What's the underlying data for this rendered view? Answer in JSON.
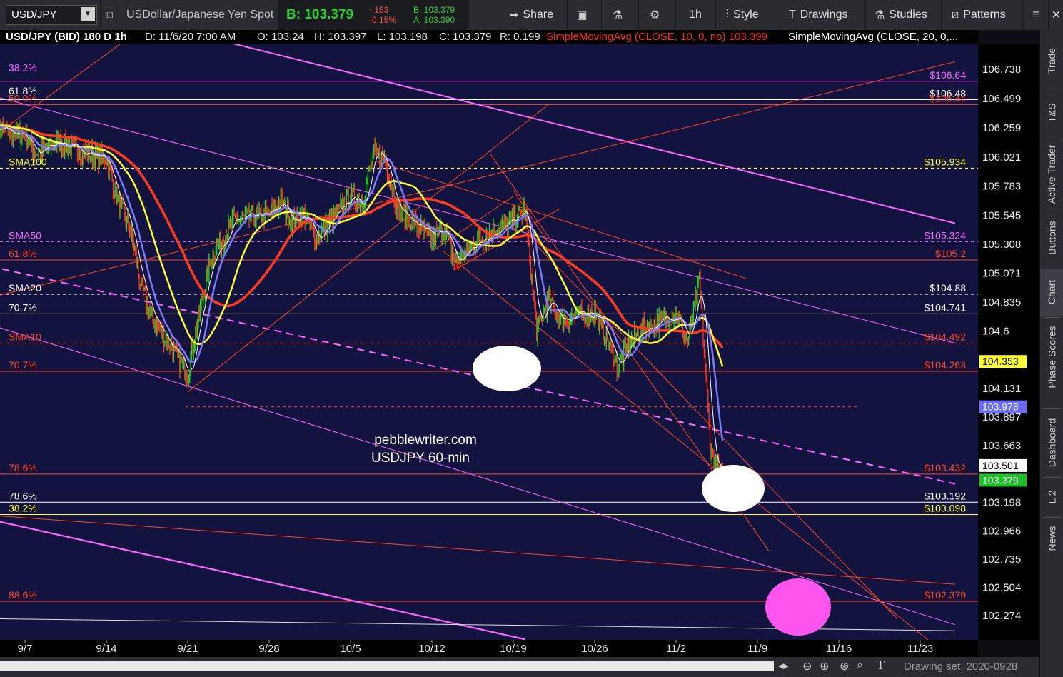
{
  "toolbar": {
    "symbol": "USD/JPY",
    "description": "USDollar/Japanese Yen Spot",
    "bid": "B: 103.379",
    "change": "-.153",
    "change_pct": "-0.15%",
    "bid_small": "B: 103.379",
    "ask_small": "A: 103.390",
    "share": "Share",
    "period": "1h",
    "style": "Style",
    "drawings": "Drawings",
    "studies": "Studies",
    "patterns": "Patterns"
  },
  "infobar": {
    "title": "USD/JPY (BID) 180 D 1h",
    "d_label": "D:",
    "d_value": "11/6/20 7:00 AM",
    "o_label": "O:",
    "o_value": "103.24",
    "h_label": "H:",
    "h_value": "103.397",
    "l_label": "L:",
    "l_value": "103.198",
    "c_label": "C:",
    "c_value": "103.379",
    "r_label": "R:",
    "r_value": "0.199",
    "sma10_label": "SimpleMovingAvg (CLOSE, 10, 0, no)",
    "sma10_value": "103.399",
    "sma20_label": "SimpleMovingAvg (CLOSE, 20, 0,..."
  },
  "sidebar": {
    "tabs": [
      "Trade",
      "T&S",
      "Active Trader",
      "Buttons",
      "Chart",
      "Phase Scores",
      "Dashboard",
      "L 2",
      "News"
    ]
  },
  "bottombar": {
    "drawing_set": "Drawing set: 2020-0928"
  },
  "chart_data": {
    "type": "candlestick",
    "title": "USD/JPY (BID) 180 D 1h",
    "watermark": [
      "pebblewriter.com",
      "USDJPY 60-min"
    ],
    "x_ticks": [
      "9/7",
      "9/14",
      "9/21",
      "9/28",
      "10/5",
      "10/12",
      "10/19",
      "10/26",
      "11/2",
      "11/9",
      "11/16",
      "11/23"
    ],
    "y_ticks": [
      "106.738",
      "106.499",
      "106.259",
      "106.021",
      "105.783",
      "105.545",
      "105.308",
      "105.071",
      "104.835",
      "104.6",
      "104.131",
      "103.897",
      "103.663",
      "103.198",
      "102.966",
      "102.735",
      "102.504",
      "102.274"
    ],
    "ylim": [
      102.15,
      106.95
    ],
    "price_path": [
      [
        "9/3",
        106.35
      ],
      [
        "9/4",
        106.25
      ],
      [
        "9/7",
        106.2
      ],
      [
        "9/8",
        106.05
      ],
      [
        "9/9",
        106.1
      ],
      [
        "9/10",
        106.15
      ],
      [
        "9/11",
        106.1
      ],
      [
        "9/14",
        106.0
      ],
      [
        "9/15",
        105.65
      ],
      [
        "9/16",
        105.45
      ],
      [
        "9/17",
        104.95
      ],
      [
        "9/18",
        104.7
      ],
      [
        "9/21",
        104.25
      ],
      [
        "9/22",
        104.75
      ],
      [
        "9/23",
        105.2
      ],
      [
        "9/24",
        105.35
      ],
      [
        "9/25",
        105.5
      ],
      [
        "9/28",
        105.55
      ],
      [
        "9/29",
        105.65
      ],
      [
        "9/30",
        105.5
      ],
      [
        "10/1",
        105.55
      ],
      [
        "10/2",
        105.35
      ],
      [
        "10/5",
        105.7
      ],
      [
        "10/6",
        105.65
      ],
      [
        "10/7",
        106.05
      ],
      [
        "10/8",
        106.0
      ],
      [
        "10/9",
        105.6
      ],
      [
        "10/12",
        105.35
      ],
      [
        "10/13",
        105.45
      ],
      [
        "10/14",
        105.15
      ],
      [
        "10/15",
        105.25
      ],
      [
        "10/16",
        105.35
      ],
      [
        "10/19",
        105.5
      ],
      [
        "10/20",
        105.6
      ],
      [
        "10/21",
        104.6
      ],
      [
        "10/22",
        104.85
      ],
      [
        "10/23",
        104.7
      ],
      [
        "10/26",
        104.75
      ],
      [
        "10/27",
        104.55
      ],
      [
        "10/28",
        104.3
      ],
      [
        "10/29",
        104.5
      ],
      [
        "10/30",
        104.6
      ],
      [
        "11/2",
        104.75
      ],
      [
        "11/3",
        104.5
      ],
      [
        "11/4",
        105.0
      ],
      [
        "11/5",
        103.6
      ],
      [
        "11/6",
        103.37
      ]
    ],
    "series": [
      {
        "name": "SMA10",
        "color": "#ffffff"
      },
      {
        "name": "SMA20",
        "color": "#7b7bff"
      },
      {
        "name": "SMA50",
        "color": "#ffff33"
      },
      {
        "name": "SMA100",
        "color": "#ff3b1f"
      }
    ],
    "left_labels": [
      {
        "text": "38.2%",
        "price": 106.7,
        "color": "#ff66ff"
      },
      {
        "text": "61.8%",
        "price": 106.51,
        "color": "#ffffff"
      },
      {
        "text": "50.0%",
        "price": 106.45,
        "color": "#ff4422"
      },
      {
        "text": "SMA100",
        "price": 105.93,
        "color": "#ffff33"
      },
      {
        "text": "SMA50",
        "price": 105.33,
        "color": "#ff66ff"
      },
      {
        "text": "61.8%",
        "price": 105.18,
        "color": "#ff4422"
      },
      {
        "text": "SMA20",
        "price": 104.9,
        "color": "#ffffff"
      },
      {
        "text": "70.7%",
        "price": 104.74,
        "color": "#ffffff"
      },
      {
        "text": "SMA10",
        "price": 104.5,
        "color": "#ff4422"
      },
      {
        "text": "70.7%",
        "price": 104.27,
        "color": "#ff4422"
      },
      {
        "text": "78.6%",
        "price": 103.43,
        "color": "#ff4422"
      },
      {
        "text": "78.6%",
        "price": 103.2,
        "color": "#ffffff"
      },
      {
        "text": "38.2%",
        "price": 103.1,
        "color": "#ffff33"
      },
      {
        "text": "88.6%",
        "price": 102.39,
        "color": "#ff4422"
      }
    ],
    "right_labels": [
      {
        "text": "$106.64",
        "price": 106.64,
        "color": "#ff66ff"
      },
      {
        "text": "$106.48",
        "price": 106.49,
        "color": "#ffffff"
      },
      {
        "text": "$106.44",
        "price": 106.45,
        "color": "#ff4422"
      },
      {
        "text": "$105.934",
        "price": 105.93,
        "color": "#ffff33"
      },
      {
        "text": "$105.324",
        "price": 105.33,
        "color": "#ff66ff"
      },
      {
        "text": "$105.2",
        "price": 105.18,
        "color": "#ff4422"
      },
      {
        "text": "$104.88",
        "price": 104.9,
        "color": "#ffffff"
      },
      {
        "text": "$104.741",
        "price": 104.74,
        "color": "#ffffff"
      },
      {
        "text": "$104.492",
        "price": 104.5,
        "color": "#ff4422"
      },
      {
        "text": "$104.263",
        "price": 104.27,
        "color": "#ff4422"
      },
      {
        "text": "$103.432",
        "price": 103.43,
        "color": "#ff4422"
      },
      {
        "text": "$103.192",
        "price": 103.2,
        "color": "#ffffff"
      },
      {
        "text": "$103.098",
        "price": 103.1,
        "color": "#ffff33"
      },
      {
        "text": "$102.379",
        "price": 102.39,
        "color": "#ff4422"
      }
    ],
    "price_badges": [
      {
        "text": "104.353",
        "price": 104.35,
        "bg": "#ffff33",
        "fg": "#000000"
      },
      {
        "text": "103.978",
        "price": 103.98,
        "bg": "#6a6aff",
        "fg": "#ffffff"
      },
      {
        "text": "103.501",
        "price": 103.5,
        "bg": "#ffffff",
        "fg": "#000000"
      },
      {
        "text": "103.379",
        "price": 103.38,
        "bg": "#1fbf2a",
        "fg": "#ffffff"
      }
    ]
  }
}
